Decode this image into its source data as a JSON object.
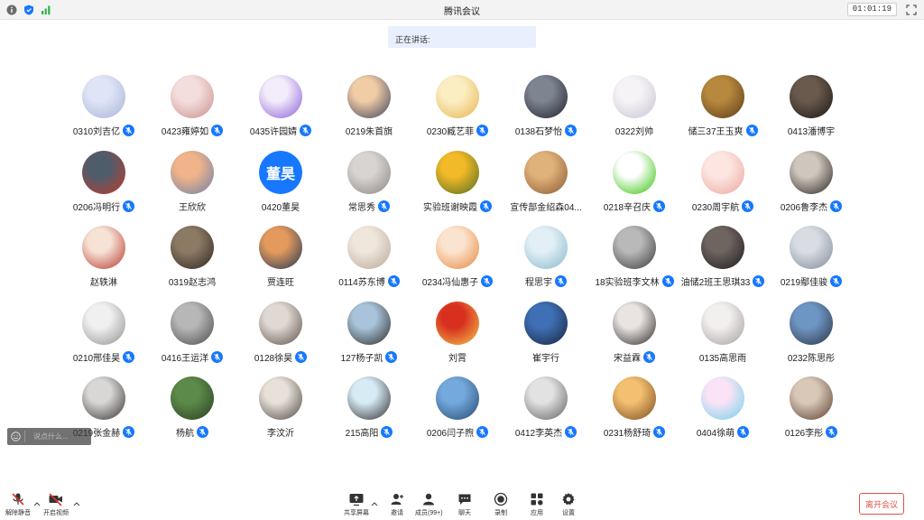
{
  "window": {
    "title": "腾讯会议",
    "timer": "01:01:19",
    "left_icons": [
      "info-icon",
      "shield-icon",
      "signal-icon"
    ]
  },
  "speaking": {
    "label": "正在讲话:"
  },
  "participants": [
    {
      "name": "0310刘吉亿",
      "avatar": "anime-girl",
      "colors": [
        "#dfe4f6",
        "#a9b2d8"
      ],
      "muted": true
    },
    {
      "name": "0423雍婷如",
      "avatar": "cartoon-girl",
      "colors": [
        "#f4dedd",
        "#c98f8b"
      ],
      "muted": true
    },
    {
      "name": "0435许园婧",
      "avatar": "purple-teletubby",
      "colors": [
        "#f2ecfb",
        "#8c5bd6"
      ],
      "muted": true
    },
    {
      "name": "0219朱首旗",
      "avatar": "sunset-sky",
      "colors": [
        "#f1cda6",
        "#3a3f5c"
      ],
      "muted": false
    },
    {
      "name": "0230臧艺菲",
      "avatar": "crayon-shinchan",
      "colors": [
        "#fbeec3",
        "#e8b34f"
      ],
      "muted": true
    },
    {
      "name": "0138石梦怡",
      "avatar": "dark-window",
      "colors": [
        "#7d8591",
        "#1f232a"
      ],
      "muted": true
    },
    {
      "name": "0322刘帅",
      "avatar": "white-anime",
      "colors": [
        "#f5f3f6",
        "#c9c3d3"
      ],
      "muted": false
    },
    {
      "name": "储三37王玉爽",
      "avatar": "soldier",
      "colors": [
        "#b7893e",
        "#5a3a17"
      ],
      "muted": true
    },
    {
      "name": "0413潘博宇",
      "avatar": "dark-room",
      "colors": [
        "#6a5a4d",
        "#1c1613"
      ],
      "muted": false
    },
    {
      "name": "0206冯明行",
      "avatar": "race-car",
      "colors": [
        "#4f5d6b",
        "#c23a2a"
      ],
      "muted": true
    },
    {
      "name": "王欣欣",
      "avatar": "pink-sunset",
      "colors": [
        "#f1b48a",
        "#6d7fa8"
      ],
      "muted": false
    },
    {
      "name": "0420董昊",
      "avatar": "text",
      "text": "董昊",
      "colors": [
        "#1677ff",
        "#1677ff"
      ],
      "muted": false
    },
    {
      "name": "常思秀",
      "avatar": "sketch-face",
      "colors": [
        "#d8d4d2",
        "#8c8582"
      ],
      "muted": true
    },
    {
      "name": "实验班谢映霞",
      "avatar": "sunflower",
      "colors": [
        "#f2b928",
        "#4d6b22"
      ],
      "muted": true
    },
    {
      "name": "宣传部金绍森04...",
      "avatar": "warm-blur",
      "colors": [
        "#e0b27b",
        "#8a5a30"
      ],
      "muted": false
    },
    {
      "name": "0218辛召庆",
      "avatar": "wechat-logo",
      "colors": [
        "#ffffff",
        "#2dc100"
      ],
      "muted": true
    },
    {
      "name": "0230周宇航",
      "avatar": "pink-bear",
      "colors": [
        "#fde6e2",
        "#e9a59b"
      ],
      "muted": true
    },
    {
      "name": "0206鲁李杰",
      "avatar": "woman-portrait",
      "colors": [
        "#cfc6bd",
        "#2a2420"
      ],
      "muted": true
    },
    {
      "name": "赵轶淋",
      "avatar": "red-anime",
      "colors": [
        "#f6e3d6",
        "#b7332a"
      ],
      "muted": false
    },
    {
      "name": "0319赵志鸿",
      "avatar": "dark-photo",
      "colors": [
        "#8c7a65",
        "#2e261f"
      ],
      "muted": false
    },
    {
      "name": "贾连旺",
      "avatar": "sea-sunset",
      "colors": [
        "#e49a5d",
        "#1e3553"
      ],
      "muted": false
    },
    {
      "name": "0114苏东博",
      "avatar": "cat-paw",
      "colors": [
        "#efe6dc",
        "#b9a897"
      ],
      "muted": true
    },
    {
      "name": "0234冯仙惠子",
      "avatar": "orange-anime",
      "colors": [
        "#fbe4cf",
        "#e7853b"
      ],
      "muted": true
    },
    {
      "name": "程思宇",
      "avatar": "blue-cartoon",
      "colors": [
        "#e2f0f6",
        "#86b6c9"
      ],
      "muted": true
    },
    {
      "name": "18实验班李文林",
      "avatar": "bw-portrait",
      "colors": [
        "#b9b9b9",
        "#3a3a3a"
      ],
      "muted": true
    },
    {
      "name": "油储2班王思琪33",
      "avatar": "dark-selfie",
      "colors": [
        "#6e6460",
        "#1e1a19"
      ],
      "muted": true
    },
    {
      "name": "0219鄢佳骏",
      "avatar": "grey-anime",
      "colors": [
        "#d9dde3",
        "#7f8a99"
      ],
      "muted": true
    },
    {
      "name": "0210邢佳昊",
      "avatar": "white-hair",
      "colors": [
        "#f0f0f0",
        "#8f8f8f"
      ],
      "muted": true
    },
    {
      "name": "0416王运洋",
      "avatar": "grey-man",
      "colors": [
        "#b7b7b7",
        "#4a4a4a"
      ],
      "muted": true
    },
    {
      "name": "0128徐昊",
      "avatar": "sketch-boy",
      "colors": [
        "#e0d8d2",
        "#5a4d47"
      ],
      "muted": true
    },
    {
      "name": "127杨子凯",
      "avatar": "silhouette-sky",
      "colors": [
        "#a9c4da",
        "#2a2a2a"
      ],
      "muted": true
    },
    {
      "name": "刘霄",
      "avatar": "china-flag",
      "colors": [
        "#d8301f",
        "#f2c94c"
      ],
      "muted": false
    },
    {
      "name": "崔宇行",
      "avatar": "boy-cap",
      "colors": [
        "#3f6fb4",
        "#17243c"
      ],
      "muted": false
    },
    {
      "name": "宋益霖",
      "avatar": "dark-anime",
      "colors": [
        "#e9e4e2",
        "#2f2725"
      ],
      "muted": true
    },
    {
      "name": "0135高思雨",
      "avatar": "white-cat",
      "colors": [
        "#f2efef",
        "#a49c9a"
      ],
      "muted": false
    },
    {
      "name": "0232陈思彤",
      "avatar": "city-street",
      "colors": [
        "#6e96c5",
        "#2c3342"
      ],
      "muted": false
    },
    {
      "name": "0219张金赫",
      "avatar": "devil-shadow",
      "colors": [
        "#d9d6d6",
        "#353131"
      ],
      "muted": true
    },
    {
      "name": "杨航",
      "avatar": "forest",
      "colors": [
        "#5c8a4a",
        "#2a3d22"
      ],
      "muted": true
    },
    {
      "name": "李汶沂",
      "avatar": "dancer",
      "colors": [
        "#e8e1da",
        "#4d4540"
      ],
      "muted": false
    },
    {
      "name": "215高阳",
      "avatar": "basketball-player",
      "colors": [
        "#d7ebf5",
        "#2c2c2c"
      ],
      "muted": true
    },
    {
      "name": "0206闫子煦",
      "avatar": "lake-sky",
      "colors": [
        "#74a9de",
        "#25486e"
      ],
      "muted": true
    },
    {
      "name": "0412李英杰",
      "avatar": "cat-cartoon",
      "colors": [
        "#e2e2e2",
        "#5f5f5f"
      ],
      "muted": true
    },
    {
      "name": "0231杨舒琦",
      "avatar": "warm-light",
      "colors": [
        "#f2c070",
        "#7a4a20"
      ],
      "muted": true
    },
    {
      "name": "0404徐萌",
      "avatar": "rainbow-cat",
      "colors": [
        "#fbe3f7",
        "#6fd1e8"
      ],
      "muted": true
    },
    {
      "name": "0126李彤",
      "avatar": "girl-portrait",
      "colors": [
        "#d9c8b8",
        "#5a3e2e"
      ],
      "muted": true
    }
  ],
  "chat": {
    "placeholder": "说点什么..."
  },
  "toolbar": {
    "unmute": "解除静音",
    "start_video": "开启视频",
    "share_screen": "共享屏幕",
    "invite": "邀请",
    "members": "成员(99+)",
    "chat": "聊天",
    "record": "录制",
    "apps": "应用",
    "settings": "设置",
    "leave": "离开会议"
  }
}
